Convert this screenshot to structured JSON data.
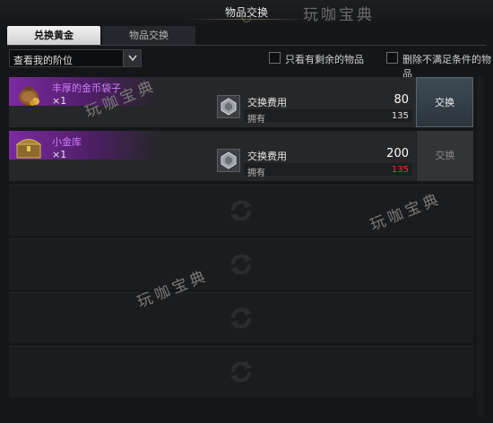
{
  "window": {
    "title": "物品交换"
  },
  "tabs": [
    {
      "label": "兑换黄金",
      "active": true
    },
    {
      "label": "物品交换",
      "active": false
    }
  ],
  "filter": {
    "selected": "查看我的阶位"
  },
  "checkboxes": [
    {
      "label": "只看有剩余的物品",
      "checked": false
    },
    {
      "label": "删除不满足条件的物品",
      "checked": false
    }
  ],
  "rows": [
    {
      "name": "丰厚的金币袋子",
      "qty": "×1",
      "cost_label": "交换费用",
      "cost": "80",
      "own_label": "拥有",
      "own": "135",
      "button": "交换",
      "enabled": true
    },
    {
      "name": "小金库",
      "qty": "×1",
      "cost_label": "交换费用",
      "cost": "200",
      "own_label": "拥有",
      "own": "135",
      "button": "交换",
      "enabled": false
    }
  ],
  "watermarks": [
    "玩咖宝典",
    "玩咖宝典",
    "玩咖宝典",
    "玩咖宝典"
  ],
  "colors": {
    "item_name": "#cf7cff",
    "insufficient": "#ff3030",
    "purple_bar": "#7c2aa0"
  },
  "icons": {
    "row1": "coin-bag-icon",
    "row2": "treasure-chest-icon",
    "cost": "silver-currency-icon",
    "empty": "refresh-icon"
  }
}
